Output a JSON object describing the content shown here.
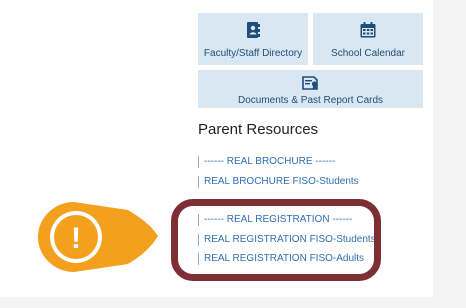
{
  "tiles": {
    "faculty_directory": {
      "label": "Faculty/Staff Directory",
      "icon": "address-book-icon"
    },
    "school_calendar": {
      "label": "School Calendar",
      "icon": "calendar-icon"
    },
    "documents": {
      "label": "Documents & Past Report Cards",
      "icon": "certificate-document-icon"
    }
  },
  "parent_resources": {
    "title": "Parent Resources",
    "links": [
      "------ REAL BROCHURE ------",
      "REAL BROCHURE FISO-Students",
      "------ REAL REGISTRATION ------",
      "REAL REGISTRATION FISO-Students",
      "REAL REGISTRATION FISO-Adults"
    ]
  },
  "annotation": {
    "callout_symbol": "!",
    "callout_color": "#f2a01e",
    "highlight_color": "#7e2f35"
  },
  "colors": {
    "tile_bg": "#d8e7f2",
    "tile_text": "#1f4d7a",
    "link": "#2f6fb0"
  }
}
